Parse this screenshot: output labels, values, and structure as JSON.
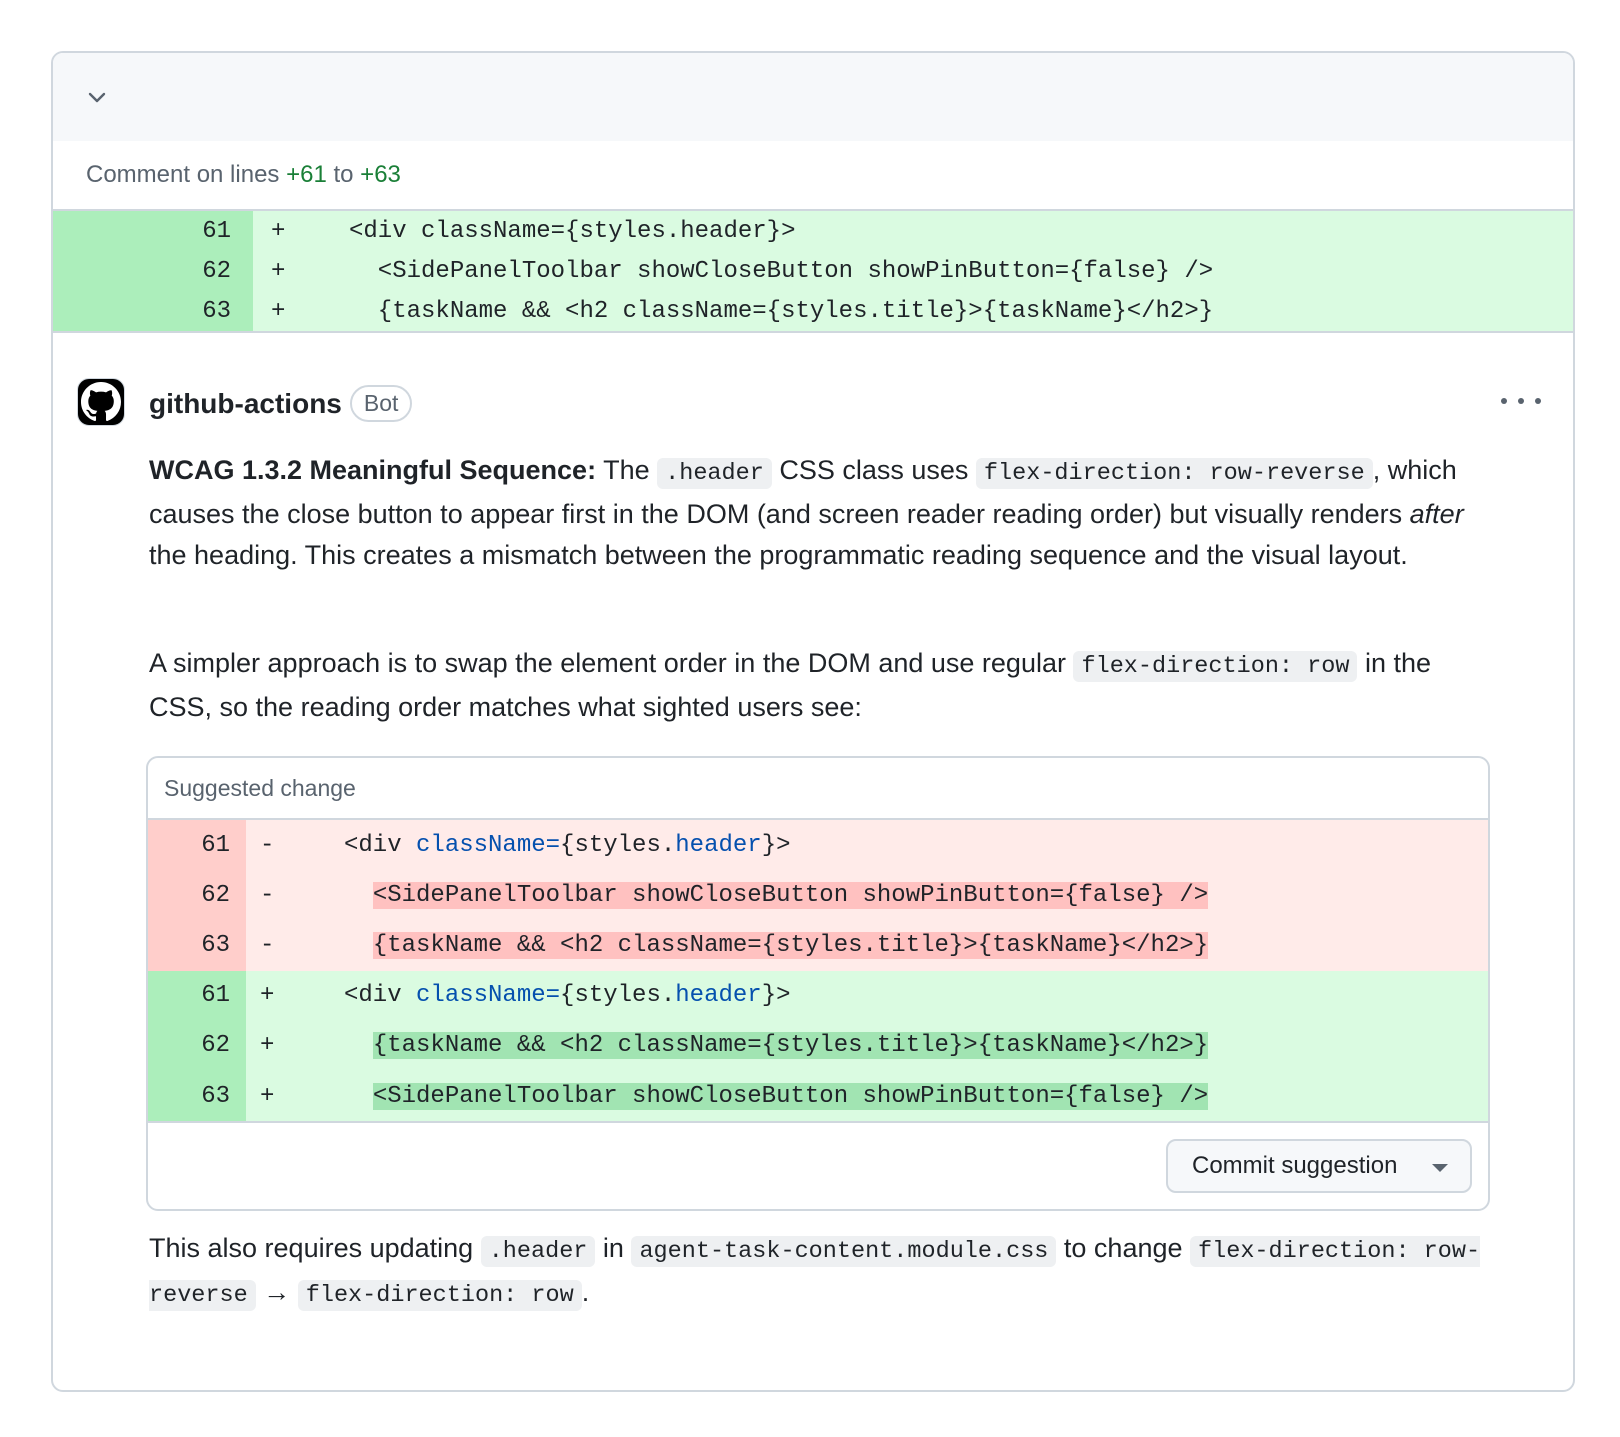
{
  "comment_range": {
    "prefix": "Comment on lines",
    "start": "+61",
    "mid": "to",
    "end": "+63"
  },
  "context_diff": [
    {
      "num": "61",
      "sign": "+",
      "code": "<div className={styles.header}>"
    },
    {
      "num": "62",
      "sign": "+",
      "code": "  <SidePanelToolbar showCloseButton showPinButton={false} />"
    },
    {
      "num": "63",
      "sign": "+",
      "code": "  {taskName && <h2 className={styles.title}>{taskName}</h2>}"
    }
  ],
  "comment": {
    "author": "github-actions",
    "badge": "Bot",
    "p1": {
      "bold": "WCAG 1.3.2 Meaningful Sequence:",
      "t1": " The ",
      "c1": ".header",
      "t2": " CSS class uses ",
      "c2": "flex-direction: row-reverse",
      "t3": ", which causes the close button to appear first in the DOM (and screen reader reading order) but visually renders ",
      "em": "after",
      "t4": " the heading. This creates a mismatch between the programmatic reading sequence and the visual layout."
    },
    "p2": {
      "t1": "A simpler approach is to swap the element order in the DOM and use regular ",
      "c1": "flex-direction: row",
      "t2": " in the CSS, so the reading order matches what sighted users see:"
    },
    "p3": {
      "t1": "This also requires updating ",
      "c1": ".header",
      "t2": " in ",
      "c2": "agent-task-content.module.css",
      "t3": " to change ",
      "c3": "flex-direction: row-reverse",
      "arrow": " → ",
      "c4": "flex-direction: row",
      "t4": "."
    }
  },
  "suggestion": {
    "title": "Suggested change",
    "del": [
      {
        "num": "61",
        "sign": "-",
        "pre": "<div ",
        "kw1": "className=",
        "mid": "{styles.",
        "kw2": "header",
        "post": "}>"
      },
      {
        "num": "62",
        "sign": "-",
        "indent": "  ",
        "hl": "<SidePanelToolbar showCloseButton showPinButton={false} />"
      },
      {
        "num": "63",
        "sign": "-",
        "indent": "  ",
        "hl": "{taskName && <h2 className={styles.title}>{taskName}</h2>}"
      }
    ],
    "add": [
      {
        "num": "61",
        "sign": "+",
        "pre": "<div ",
        "kw1": "className=",
        "mid": "{styles.",
        "kw2": "header",
        "post": "}>"
      },
      {
        "num": "62",
        "sign": "+",
        "indent": "  ",
        "hl": "{taskName && <h2 className={styles.title}>{taskName}</h2>}"
      },
      {
        "num": "63",
        "sign": "+",
        "indent": "  ",
        "hl": "<SidePanelToolbar showCloseButton showPinButton={false} />"
      }
    ],
    "commit_label": "Commit suggestion"
  }
}
